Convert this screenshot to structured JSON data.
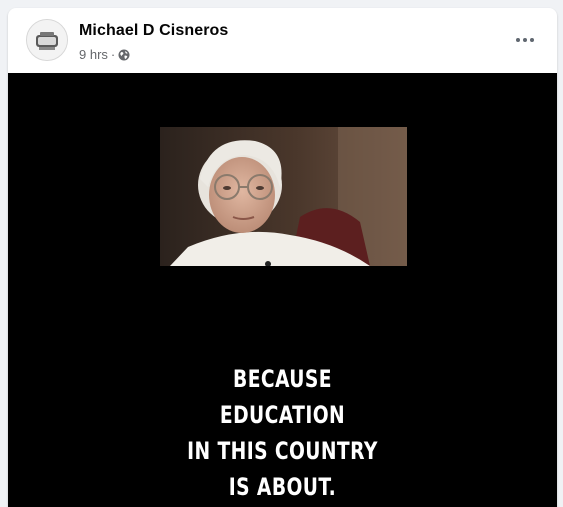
{
  "post": {
    "author": "Michael D Cisneros",
    "time": "9 hrs",
    "separator": "·",
    "privacy_icon": "globe-icon",
    "more_icon": "more-options-icon",
    "caption_lines": [
      "BECAUSE",
      "EDUCATION",
      "IN THIS COUNTRY",
      "IS ABOUT."
    ]
  },
  "colors": {
    "name": "#050505",
    "meta": "#65676b",
    "video_bg": "#000000",
    "caption": "#ffffff"
  }
}
